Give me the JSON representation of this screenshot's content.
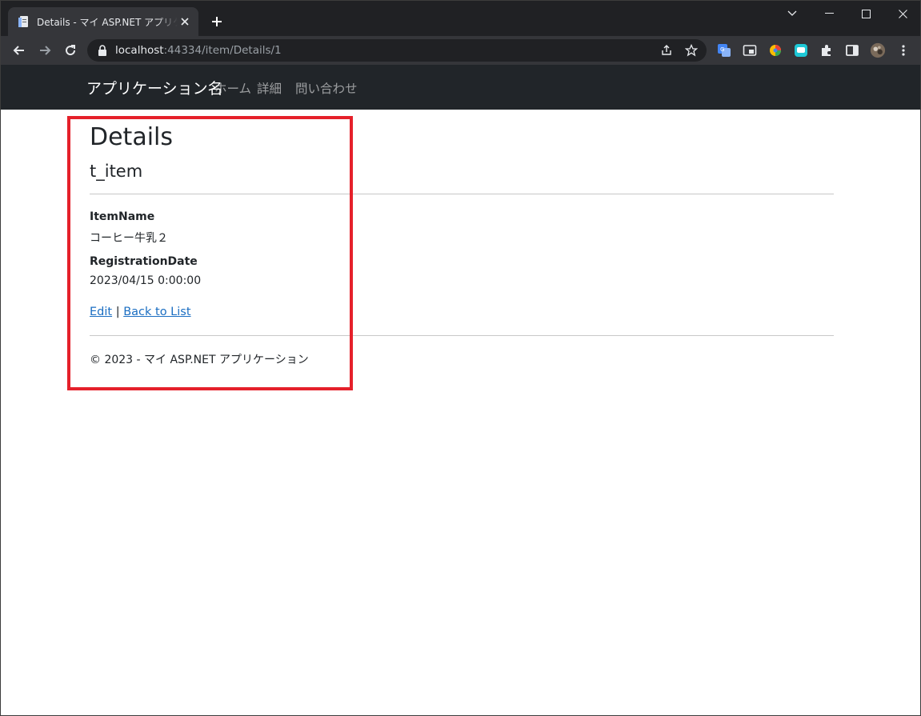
{
  "browser": {
    "tab": {
      "title": "Details - マイ ASP.NET アプリケーション"
    },
    "address": {
      "host": "localhost",
      "rest": ":44334/item/Details/1"
    }
  },
  "navbar": {
    "brand": "アプリケーション名",
    "links": [
      "ホーム",
      "詳細",
      "問い合わせ"
    ]
  },
  "page": {
    "title": "Details",
    "subtitle": "t_item",
    "fields": [
      {
        "label": "ItemName",
        "value": "コーヒー牛乳２"
      },
      {
        "label": "RegistrationDate",
        "value": "2023/04/15 0:00:00"
      }
    ],
    "actions": {
      "edit": "Edit",
      "separator": "|",
      "back": "Back to List"
    },
    "footer": "© 2023 - マイ ASP.NET アプリケーション"
  },
  "colors": {
    "tabstrip": "#202124",
    "toolbar": "#35363a",
    "navbar": "#212529",
    "link": "#1b6ec2",
    "highlight": "#e5202a"
  }
}
